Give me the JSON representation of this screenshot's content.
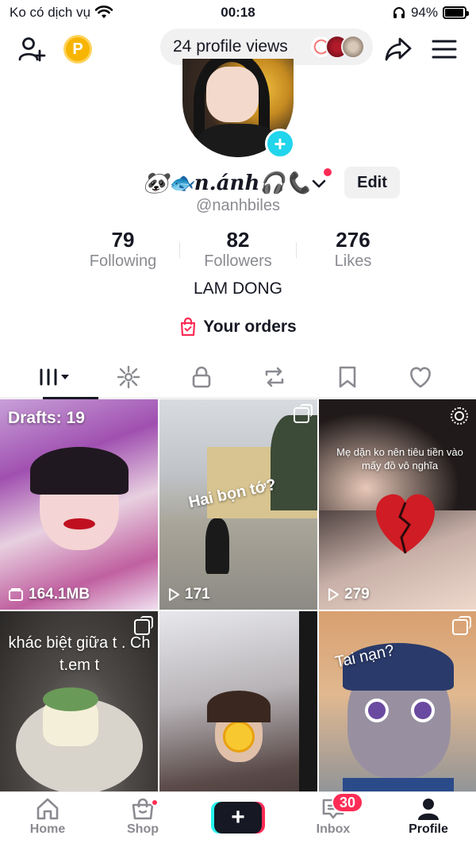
{
  "status_bar": {
    "carrier": "Ko có dịch vụ",
    "time": "00:18",
    "battery": "94%",
    "battery_level": 0.94,
    "wifi_icon": "wifi-icon",
    "headphones_icon": "headphones-icon"
  },
  "top_bar": {
    "profile_views": "24 profile views",
    "coin_label": "P"
  },
  "profile": {
    "display_name": "🐼🐟𝒏.á𝒏𝒉🎧📞",
    "edit_label": "Edit",
    "username": "@nanhbiles",
    "add_label": "+",
    "region": "LAM DONG",
    "orders_label": "Your orders"
  },
  "stats": [
    {
      "value": "79",
      "label": "Following"
    },
    {
      "value": "82",
      "label": "Followers"
    },
    {
      "value": "276",
      "label": "Likes"
    }
  ],
  "tabs": [
    {
      "name": "videos",
      "icon": "grid-icon",
      "active": true
    },
    {
      "name": "private",
      "icon": "sparkle-icon"
    },
    {
      "name": "locked",
      "icon": "lock-icon"
    },
    {
      "name": "reposts",
      "icon": "repost-icon"
    },
    {
      "name": "favorites",
      "icon": "bookmark-icon"
    },
    {
      "name": "liked",
      "icon": "heart-icon"
    }
  ],
  "grid": {
    "drafts_label": "Drafts: 19",
    "drafts_size": "164.1MB",
    "tile2_caption": "Hai bọn tớ?",
    "tile2_views": "171",
    "tile3_caption": "Mẹ dặn ko nên tiêu tiền vào mấy đồ vô nghĩa",
    "tile3_views": "279",
    "tile4_caption": "khác biệt giữa t . Ch t.em t",
    "tile6_caption": "Tai nạn?"
  },
  "bottom_nav": {
    "home": "Home",
    "shop": "Shop",
    "create": "+",
    "inbox": "Inbox",
    "inbox_badge": "30",
    "profile": "Profile"
  },
  "colors": {
    "accent": "#fe2c55",
    "cyan": "#25f4ee",
    "text": "#161823",
    "muted": "#8a8b91"
  }
}
